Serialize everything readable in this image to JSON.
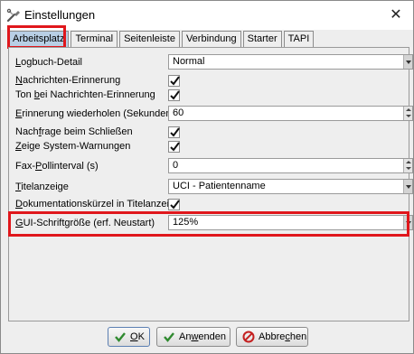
{
  "window": {
    "title": "Einstellungen",
    "close_glyph": "✕"
  },
  "tabs": [
    {
      "label": "Arbeitsplatz",
      "active": true
    },
    {
      "label": "Terminal"
    },
    {
      "label": "Seitenleiste"
    },
    {
      "label": "Verbindung"
    },
    {
      "label": "Starter"
    },
    {
      "label": "TAPI"
    }
  ],
  "settings": {
    "logbuch_detail": {
      "label_mnemonic": "L",
      "label_rest": "ogbuch-Detail",
      "value": "Normal"
    },
    "nachrichten_erinnerung": {
      "label_mnemonic": "N",
      "label_rest": "achrichten-Erinnerung",
      "checked": true
    },
    "ton_erinnerung": {
      "label_pre": "Ton ",
      "label_mnemonic": "b",
      "label_rest": "ei Nachrichten-Erinnerung",
      "checked": true
    },
    "erinnerung_wiederholen": {
      "label_mnemonic": "E",
      "label_rest": "rinnerung wiederholen (Sekunden)",
      "value": "60"
    },
    "nachfrage_schliessen": {
      "label_pre": "Nach",
      "label_mnemonic": "f",
      "label_rest": "rage beim Schließen",
      "checked": true
    },
    "system_warnungen": {
      "label_mnemonic": "Z",
      "label_rest": "eige System-Warnungen",
      "checked": true
    },
    "fax_pollinterval": {
      "label_pre": "Fax-",
      "label_mnemonic": "P",
      "label_rest": "ollinterval (s)",
      "value": "0"
    },
    "titelanzeige": {
      "label_mnemonic": "T",
      "label_rest": "itelanzeige",
      "value": "UCI - Patientenname"
    },
    "dokumentationskuerzel": {
      "label_mnemonic": "D",
      "label_rest": "okumentationskürzel in Titelanzeige",
      "checked": true
    },
    "gui_schriftgroesse": {
      "label_mnemonic": "G",
      "label_rest": "UI-Schriftgröße (erf. Neustart)",
      "value": "125%"
    }
  },
  "footer": {
    "ok_mnemonic": "O",
    "ok_rest": "K",
    "apply_pre": "An",
    "apply_mnemonic": "w",
    "apply_rest": "enden",
    "cancel_pre": "Abbre",
    "cancel_mnemonic": "c",
    "cancel_rest": "hen"
  },
  "colors": {
    "highlight": "#e0171c",
    "active_tab": "#b8cfe5",
    "ok_check": "#2f8a2f",
    "cancel_icon": "#c42020"
  }
}
